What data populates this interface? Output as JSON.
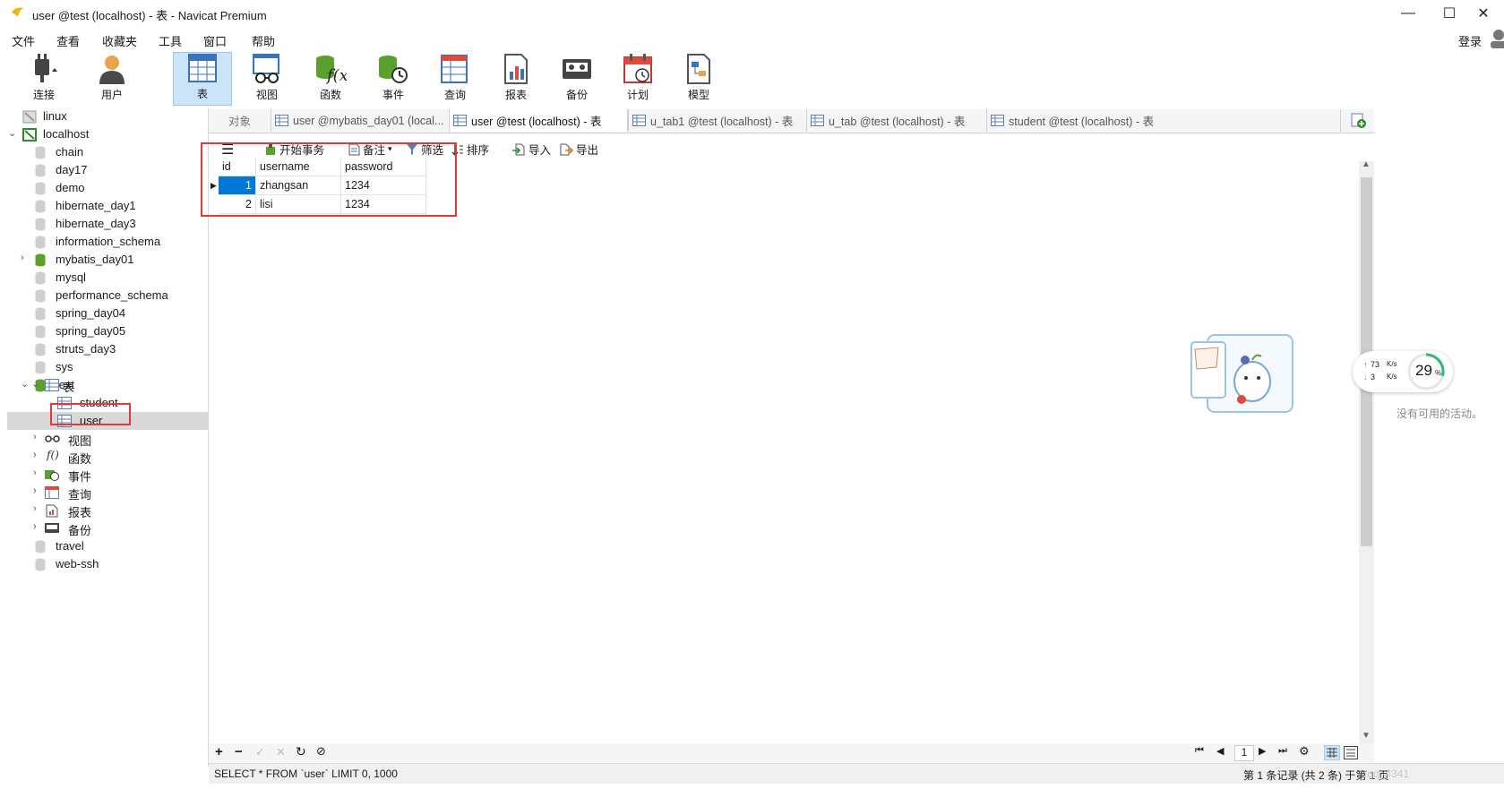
{
  "window": {
    "title": "user @test (localhost) - 表 - Navicat Premium",
    "minimize": "—",
    "maximize": "☐",
    "close": "✕"
  },
  "menu": [
    "文件",
    "查看",
    "收藏夹",
    "工具",
    "窗口",
    "帮助"
  ],
  "account": {
    "login_label": "登录"
  },
  "toolbar": [
    {
      "label": "连接",
      "icon": "plug-icon"
    },
    {
      "label": "用户",
      "icon": "user-icon"
    },
    {
      "label": "表",
      "icon": "table-icon",
      "active": true
    },
    {
      "label": "视图",
      "icon": "view-glasses-icon"
    },
    {
      "label": "函数",
      "icon": "function-icon"
    },
    {
      "label": "事件",
      "icon": "event-clock-icon"
    },
    {
      "label": "查询",
      "icon": "query-icon"
    },
    {
      "label": "报表",
      "icon": "report-icon"
    },
    {
      "label": "备份",
      "icon": "backup-icon"
    },
    {
      "label": "计划",
      "icon": "schedule-calendar-icon"
    },
    {
      "label": "模型",
      "icon": "model-icon"
    }
  ],
  "tree": {
    "connections": [
      {
        "label": "linux"
      },
      {
        "label": "localhost"
      }
    ],
    "databases": [
      "chain",
      "day17",
      "demo",
      "hibernate_day1",
      "hibernate_day3",
      "information_schema",
      "mybatis_day01",
      "mysql",
      "performance_schema",
      "spring_day04",
      "spring_day05",
      "struts_day3",
      "sys",
      "test"
    ],
    "test_children": {
      "tables_label": "表",
      "tables": [
        "student",
        "user"
      ],
      "views": "视图",
      "functions": "函数",
      "events": "事件",
      "queries": "查询",
      "reports": "报表",
      "backups": "备份"
    },
    "after": [
      "travel",
      "web-ssh"
    ]
  },
  "tabs": [
    {
      "label": "对象"
    },
    {
      "label": "user @mybatis_day01 (local..."
    },
    {
      "label": "user @test (localhost) - 表",
      "active": true
    },
    {
      "label": "u_tab1 @test (localhost) - 表"
    },
    {
      "label": "u_tab @test (localhost) - 表"
    },
    {
      "label": "student @test (localhost) - 表"
    }
  ],
  "grid_toolbar": {
    "begin_tx": "开始事务",
    "memo": "备注",
    "filter": "筛选",
    "sort": "排序",
    "import": "导入",
    "export": "导出"
  },
  "grid": {
    "columns": [
      "id",
      "username",
      "password"
    ],
    "rows": [
      [
        "1",
        "zhangsan",
        "1234"
      ],
      [
        "2",
        "lisi",
        "1234"
      ]
    ]
  },
  "right_panel": {
    "no_activity": "没有可用的活动。",
    "net_up": "73",
    "net_down": "3",
    "unit": "K/s",
    "percent": "29",
    "percent_sign": "%"
  },
  "bottom": {
    "page": "1",
    "sql": "SELECT * FROM `user` LIMIT 0, 1000",
    "record_info": "第 1 条记录 (共 2 条) 于第 1 页",
    "watermark": "/qq_4341"
  }
}
